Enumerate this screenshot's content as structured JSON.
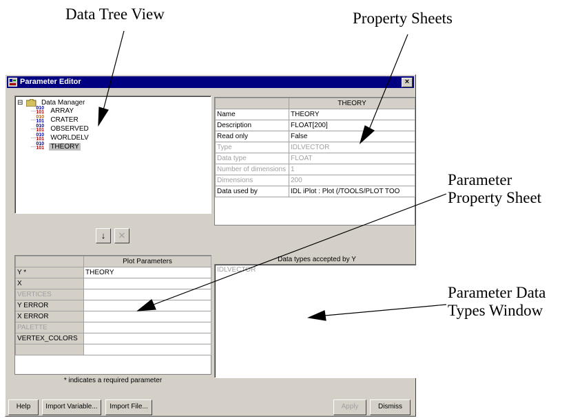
{
  "annotations": {
    "data_tree_view": "Data Tree View",
    "property_sheets": "Property Sheets",
    "parameter_property_sheet": [
      "Parameter",
      "Property Sheet"
    ],
    "parameter_data_types_window": [
      "Parameter Data",
      "Types Window"
    ]
  },
  "window": {
    "title": "Parameter Editor",
    "close_glyph": "×",
    "title_icon": "parameter-editor-icon"
  },
  "tree": {
    "root_label": "Data Manager",
    "expander_glyph": "⊟",
    "items": [
      {
        "label": "ARRAY",
        "icon": "array-data-icon"
      },
      {
        "label": "CRATER",
        "icon": "crater-data-icon"
      },
      {
        "label": "OBSERVED",
        "icon": "vector-data-icon"
      },
      {
        "label": "WORLDELV",
        "icon": "array-data-icon"
      },
      {
        "label": "THEORY",
        "icon": "vector-data-icon",
        "selected": true
      }
    ]
  },
  "property_sheet": {
    "header": "THEORY",
    "rows": [
      {
        "name": "Name",
        "value": "THEORY",
        "disabled": false
      },
      {
        "name": "Description",
        "value": "FLOAT[200]",
        "disabled": false
      },
      {
        "name": "Read only",
        "value": "False",
        "disabled": false
      },
      {
        "name": "Type",
        "value": "IDLVECTOR",
        "disabled": true
      },
      {
        "name": "Data type",
        "value": "FLOAT",
        "disabled": true
      },
      {
        "name": "Number of dimensions",
        "value": "1",
        "disabled": true
      },
      {
        "name": "Dimensions",
        "value": "200",
        "disabled": true
      },
      {
        "name": "Data used by",
        "value": "IDL iPlot : Plot  (/TOOLS/PLOT TOO",
        "disabled": false
      }
    ]
  },
  "buttons": {
    "insert_glyph": "↓",
    "remove_glyph": "✕",
    "help": "Help",
    "import_variable": "Import Variable...",
    "import_file": "Import File...",
    "apply": "Apply",
    "dismiss": "Dismiss"
  },
  "plot_parameters": {
    "header": "Plot Parameters",
    "rows": [
      {
        "name": "Y *",
        "value": "THEORY",
        "disabled": false
      },
      {
        "name": "X",
        "value": "",
        "disabled": false
      },
      {
        "name": "VERTICES",
        "value": "",
        "disabled": true
      },
      {
        "name": "Y ERROR",
        "value": "",
        "disabled": false
      },
      {
        "name": "X ERROR",
        "value": "",
        "disabled": false
      },
      {
        "name": "PALETTE",
        "value": "",
        "disabled": true
      },
      {
        "name": "VERTEX_COLORS",
        "value": "",
        "disabled": false
      },
      {
        "name": "",
        "value": "",
        "disabled": false
      }
    ],
    "required_note": "* indicates a required parameter"
  },
  "data_types": {
    "label": "Data types accepted by Y",
    "items": [
      "IDLVECTOR"
    ]
  }
}
